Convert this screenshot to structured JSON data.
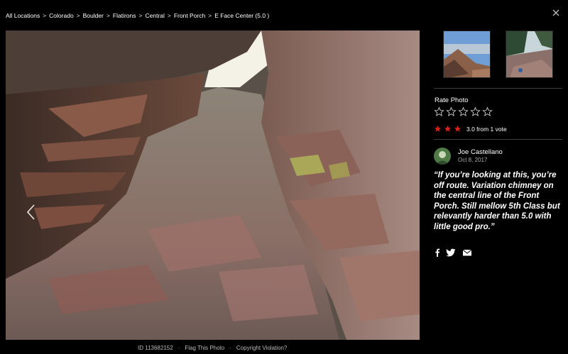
{
  "breadcrumb": [
    "All Locations",
    "Colorado",
    "Boulder",
    "Flatirons",
    "Central",
    "Front Porch",
    "E Face Center (5.0 )"
  ],
  "breadcrumb_separator": ">",
  "rating": {
    "label": "Rate Photo",
    "max_stars": 5,
    "filled_stars": 3,
    "summary": "3.0 from 1 vote"
  },
  "comment": {
    "author": "Joe Castellano",
    "date": "Oct 8, 2017",
    "text": "“If you’re looking at this, you’re off route. Variation chimney on the central line of the Front Porch. Still mellow 5th Class but relevantly harder than 5.0 with little good pro.”"
  },
  "footer": {
    "id_text": "ID 113682152",
    "separator": "·",
    "flag": "Flag This Photo",
    "copyright": "Copyright Violation?"
  },
  "icons": {
    "close": "close-icon",
    "prev": "chevron-left-icon",
    "share": [
      "facebook-icon",
      "twitter-icon",
      "email-icon"
    ]
  },
  "colors": {
    "background": "#000000",
    "star_filled": "#e0201b",
    "text": "#ffffff",
    "muted": "#aaaaaa"
  }
}
